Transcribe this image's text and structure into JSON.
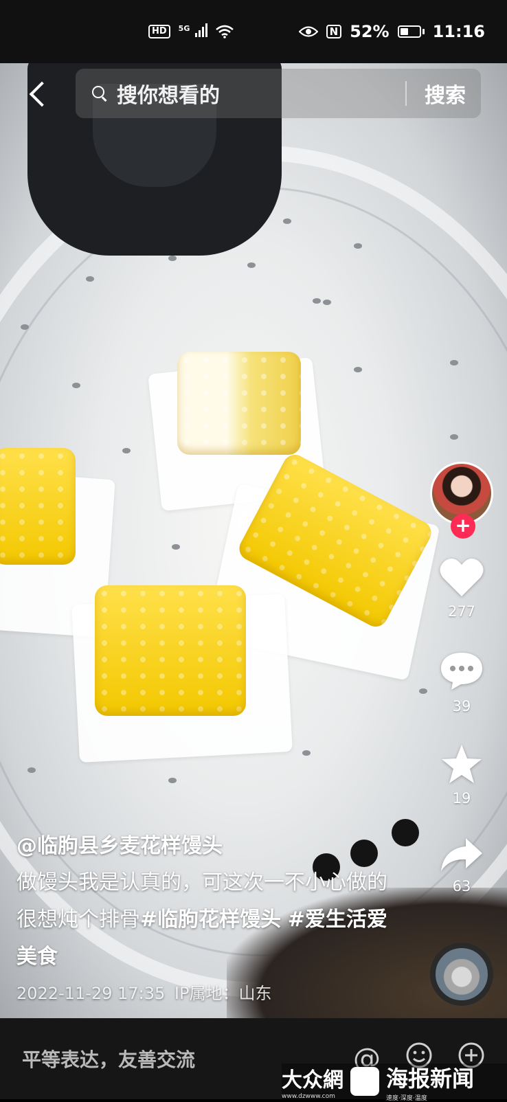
{
  "status_bar": {
    "hd": "HD",
    "network": "5G",
    "battery": "52%",
    "battery_level": 0.52,
    "time": "11:16",
    "nfc": "N"
  },
  "search": {
    "placeholder": "搜你想看的",
    "button": "搜索"
  },
  "right_rail": {
    "likes": "277",
    "comments": "39",
    "favorites": "19",
    "shares": "63",
    "follow_symbol": "+"
  },
  "caption": {
    "author": "@临朐县乡麦花样馒头",
    "desc_part1": "做馒头我是认真的，可这次一不小心做的很想炖个排骨",
    "hashtag1": "#临朐花样馒头",
    "hashtag2": "#爱生活爱美食",
    "date": "2022-11-29 17:35",
    "ip_location": "IP属地：山东"
  },
  "comment_bar": {
    "placeholder": "平等表达，友善交流",
    "at_symbol": "@"
  },
  "watermark": {
    "brand1": "大众網",
    "brand1_sub": "www.dzwww.com",
    "brand2": "海报新闻",
    "brand2_sub": "速度·深度·温度"
  },
  "colors": {
    "accent": "#fe2c55",
    "corn_yellow": "#f3c800"
  }
}
